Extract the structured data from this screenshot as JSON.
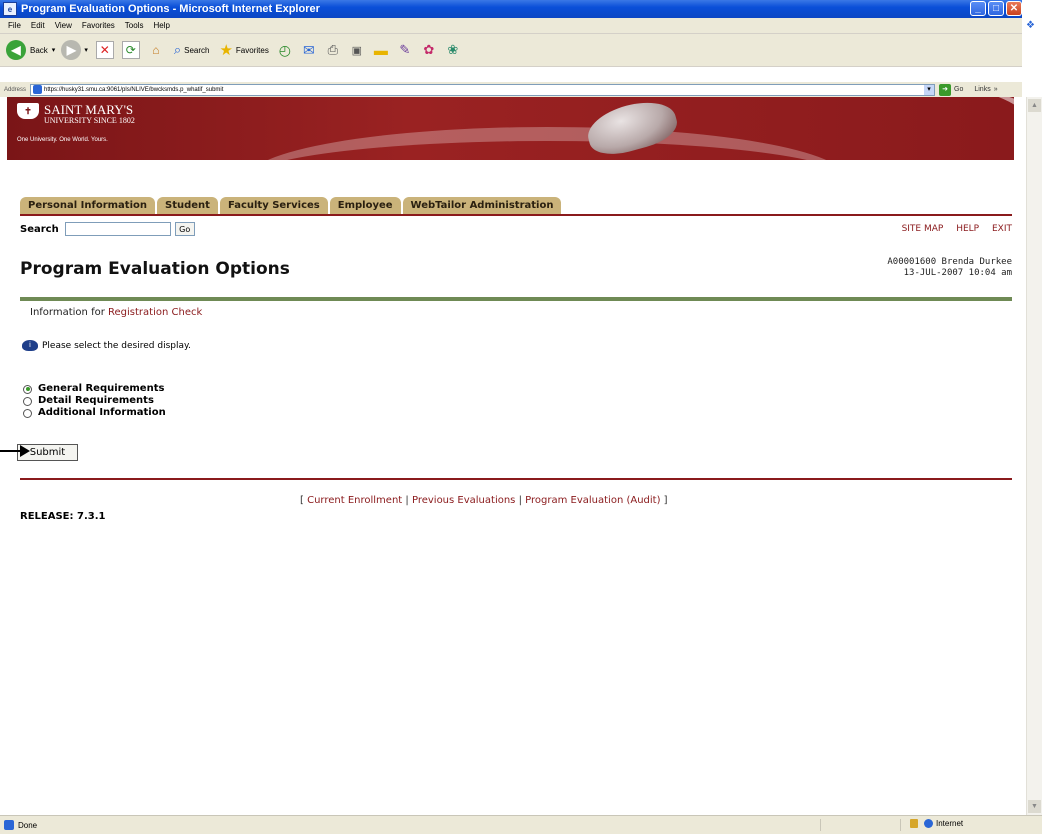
{
  "window": {
    "title": "Program Evaluation Options - Microsoft Internet Explorer",
    "controls": {
      "minimize": "_",
      "maximize": "□",
      "close": "✕"
    }
  },
  "menu": [
    "File",
    "Edit",
    "View",
    "Favorites",
    "Tools",
    "Help"
  ],
  "toolbar": {
    "back_label": "Back",
    "search_label": "Search",
    "favorites_label": "Favorites",
    "icons": [
      "back-icon",
      "forward-icon",
      "stop-icon",
      "refresh-icon",
      "home-icon",
      "search-icon",
      "favorites-icon",
      "history-icon",
      "mail-icon",
      "print-icon",
      "edit-icon",
      "folder-icon",
      "research-icon",
      "messenger-icon",
      "extra-icon"
    ]
  },
  "address": {
    "label": "Address",
    "url": "https://husky31.smu.ca:9061/pls/NLIVE/bwcksmds.p_whatif_submit",
    "go_label": "Go",
    "links_label": "Links"
  },
  "banner": {
    "logo_line1": "SAINT MARY'S",
    "logo_line2": "UNIVERSITY SINCE 1802",
    "tagline": "One University. One World. Yours.",
    "colors": {
      "primary": "#8a1a1c",
      "tab": "#cab37a",
      "divider": "#6f8a55"
    }
  },
  "tabs": [
    "Personal Information",
    "Student",
    "Faculty Services",
    "Employee",
    "WebTailor Administration"
  ],
  "search": {
    "label": "Search",
    "value": "",
    "go_label": "Go"
  },
  "toplinks": [
    "SITE MAP",
    "HELP",
    "EXIT"
  ],
  "page": {
    "title": "Program Evaluation Options",
    "user_line": "A00001600 Brenda Durkee",
    "date_line": "13-JUL-2007 10:04 am",
    "info_prefix": "Information for",
    "info_link": "Registration Check",
    "note": "Please select the desired display.",
    "options": [
      {
        "label": "General Requirements",
        "selected": true
      },
      {
        "label": "Detail Requirements",
        "selected": false
      },
      {
        "label": "Additional Information",
        "selected": false
      }
    ],
    "submit_label": "Submit",
    "footer_links": [
      "Current Enrollment",
      "Previous Evaluations",
      "Program Evaluation (Audit)"
    ],
    "release": "RELEASE: 7.3.1"
  },
  "status": {
    "text": "Done",
    "zone": "Internet"
  }
}
